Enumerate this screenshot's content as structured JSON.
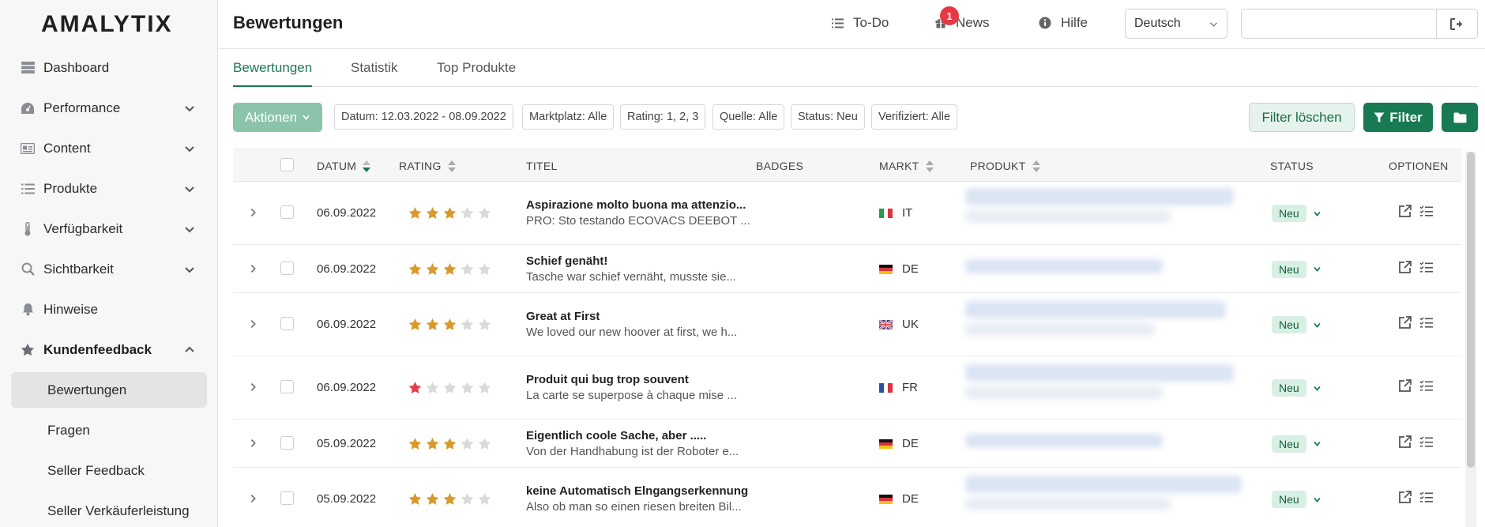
{
  "app": {
    "logo": "AMALYTIX"
  },
  "sidebar": {
    "items": [
      {
        "label": "Dashboard",
        "icon": "dashboard-icon",
        "chevron": false
      },
      {
        "label": "Performance",
        "icon": "gauge-icon",
        "chevron": true
      },
      {
        "label": "Content",
        "icon": "content-icon",
        "chevron": true
      },
      {
        "label": "Produkte",
        "icon": "list-icon",
        "chevron": true
      },
      {
        "label": "Verfügbarkeit",
        "icon": "thermometer-icon",
        "chevron": true
      },
      {
        "label": "Sichtbarkeit",
        "icon": "search-icon",
        "chevron": true
      },
      {
        "label": "Hinweise",
        "icon": "bell-icon",
        "chevron": false
      },
      {
        "label": "Kundenfeedback",
        "icon": "star-icon",
        "chevron": true,
        "expanded": true
      }
    ],
    "subitems": [
      {
        "label": "Bewertungen",
        "active": true
      },
      {
        "label": "Fragen"
      },
      {
        "label": "Seller Feedback"
      },
      {
        "label": "Seller Verkäuferleistung"
      }
    ]
  },
  "header": {
    "title": "Bewertungen",
    "todo_label": "To-Do",
    "news_label": "News",
    "news_count": "1",
    "help_label": "Hilfe",
    "language": "Deutsch",
    "search_value": ""
  },
  "tabs": [
    {
      "label": "Bewertungen",
      "active": true
    },
    {
      "label": "Statistik"
    },
    {
      "label": "Top Produkte"
    }
  ],
  "filters": {
    "actions_label": "Aktionen",
    "chips": [
      "Datum: 12.03.2022 - 08.09.2022",
      "Marktplatz: Alle",
      "Rating: 1, 2, 3",
      "Quelle: Alle",
      "Status: Neu",
      "Verifiziert: Alle"
    ],
    "clear_label": "Filter löschen",
    "filter_label": "Filter"
  },
  "table": {
    "columns": [
      "DATUM",
      "RATING",
      "TITEL",
      "BADGES",
      "MARKT",
      "PRODUKT",
      "STATUS",
      "OPTIONEN"
    ],
    "rows": [
      {
        "date": "06.09.2022",
        "rating": 3,
        "title": "Aspirazione molto buona ma attenzio...",
        "subtitle": "PRO: Sto testando ECOVACS DEEBOT ...",
        "market": "IT",
        "flag": "it",
        "status": "Neu"
      },
      {
        "date": "06.09.2022",
        "rating": 3,
        "title": "Schief genäht!",
        "subtitle": "Tasche war schief vernäht, musste sie...",
        "market": "DE",
        "flag": "de",
        "status": "Neu"
      },
      {
        "date": "06.09.2022",
        "rating": 3,
        "title": "Great at First",
        "subtitle": "We loved our new hoover at first, we h...",
        "market": "UK",
        "flag": "uk",
        "status": "Neu"
      },
      {
        "date": "06.09.2022",
        "rating": 1,
        "title": "Produit qui bug trop souvent",
        "subtitle": "La carte se superpose à chaque mise ...",
        "market": "FR",
        "flag": "fr",
        "status": "Neu"
      },
      {
        "date": "05.09.2022",
        "rating": 3,
        "title": "Eigentlich coole Sache, aber .....",
        "subtitle": "Von der Handhabung ist der Roboter e...",
        "market": "DE",
        "flag": "de",
        "status": "Neu"
      },
      {
        "date": "05.09.2022",
        "rating": 3,
        "title": "keine Automatisch Elngangserkennung",
        "subtitle": "Also ob man so einen riesen breiten Bil...",
        "market": "DE",
        "flag": "de",
        "status": "Neu"
      }
    ]
  },
  "colors": {
    "accent": "#177a52",
    "star_gold": "#d99a2b",
    "star_red": "#e0404c",
    "star_empty": "#d9dadd",
    "badge_red": "#e53946"
  }
}
